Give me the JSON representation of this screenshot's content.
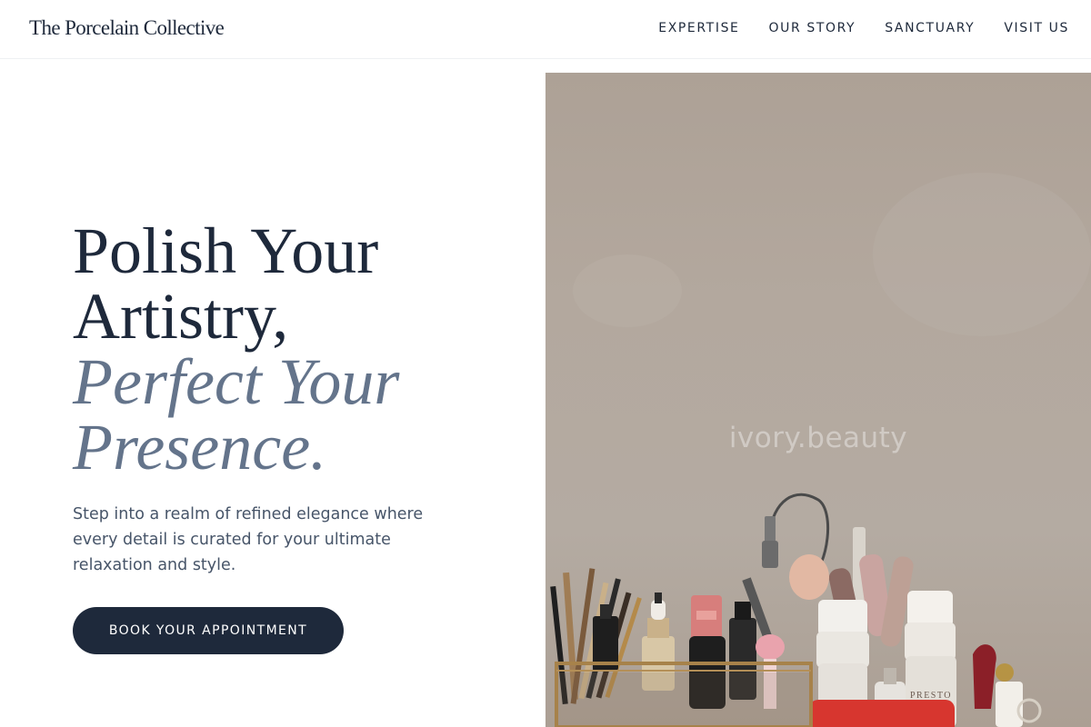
{
  "header": {
    "brand": "The Porcelain Collective",
    "nav": [
      {
        "label": "EXPERTISE"
      },
      {
        "label": "OUR STORY"
      },
      {
        "label": "SANCTUARY"
      },
      {
        "label": "VISIT US"
      }
    ]
  },
  "hero": {
    "title_lines": [
      "Polish Your",
      "Artistry,"
    ],
    "accent_lines": [
      "Perfect Your",
      "Presence."
    ],
    "description": "Step into a realm of refined elegance where every detail is curated for your ultimate relaxation and style.",
    "cta_label": "BOOK YOUR APPOINTMENT"
  },
  "image": {
    "watermark": "ivory.beauty",
    "bottle_label": "PRESTO"
  },
  "colors": {
    "primary": "#1e293b",
    "accent": "#64748b",
    "body_text": "#475569",
    "image_bg": "#b3a89e"
  }
}
